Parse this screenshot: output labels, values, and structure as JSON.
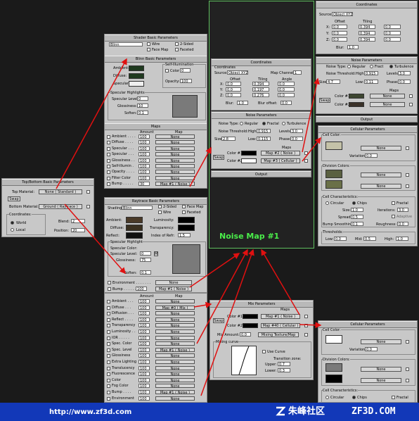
{
  "footer": {
    "url": "http://www.zf3d.com",
    "brand_cn": "朱峰社区",
    "brand_en": "ZF3D.COM"
  },
  "callout": {
    "noise_map_1": "Noise Map #1"
  },
  "shader_basic": {
    "title": "Shader Basic Parameters",
    "shader": "Blinn",
    "wire": "Wire",
    "two_sided": "2-Sided",
    "face_map": "Face Map",
    "faceted": "Faceted"
  },
  "blinn_basic": {
    "title": "Blinn Basic Parameters",
    "self_illum": "Self-Illumination",
    "ambient": "Ambient:",
    "diffuse": "Diffuse:",
    "specular": "Specular:",
    "color": "Color",
    "color_val": "0",
    "opacity": "Opacity:",
    "opacity_val": "100",
    "spec_highlights": "Specular Highlights",
    "spec_level": "Specular Level:",
    "spec_level_val": "0",
    "glossiness": "Glossiness:",
    "glossiness_val": "10",
    "soften": "Soften:",
    "soften_val": "0.1"
  },
  "maps1": {
    "title": "Maps",
    "amount": "Amount",
    "map": "Map",
    "rows": [
      {
        "name": "Ambient . . . .",
        "amt": "100",
        "map": "None"
      },
      {
        "name": "Diffuse . . . .",
        "amt": "100",
        "map": "None"
      },
      {
        "name": "Specular . . .",
        "amt": "100",
        "map": "None"
      },
      {
        "name": "Specular . . .",
        "amt": "100",
        "map": "None"
      },
      {
        "name": "Glossiness . .",
        "amt": "100",
        "map": "None"
      },
      {
        "name": "Self-Illumin .",
        "amt": "100",
        "map": "None"
      },
      {
        "name": "Opacity . . . .",
        "amt": "100",
        "map": "None"
      },
      {
        "name": "Filter Color",
        "amt": "100",
        "map": "None"
      },
      {
        "name": "Bump . . . . .",
        "amt": "30",
        "map": "Map #1 ( Noise )"
      }
    ]
  },
  "topbottom": {
    "title": "Top/Bottom Basic Parameters",
    "top_material": "Top Material:",
    "top_val": "None ( Standard )",
    "swap": "Swap",
    "bottom_material": "Bottom Material:",
    "bottom_val": "Ground ( Raytrace )",
    "coordinates": "Coordinates:",
    "world": "World",
    "local": "Local",
    "blend": "Blend:",
    "blend_val": "2",
    "position": "Position:",
    "position_val": "20"
  },
  "coord1": {
    "title": "Coordinates",
    "coordinates": "Coordinates",
    "source": "Source:",
    "source_val": "Object XYZ",
    "map_channel": "Map Channel:",
    "map_channel_val": "1",
    "offset": "Offset",
    "tiling": "Tiling",
    "angle": "Angle",
    "x": "X:",
    "y": "Y:",
    "z": "Z:",
    "ox": "0.0",
    "oy": "0.0",
    "oz": "0.0",
    "tx": "0.394",
    "ty": "0.197",
    "tz": "0.276",
    "ax": "0.0",
    "ay": "0.0",
    "az": "0.0",
    "blur": "Blur:",
    "blur_val": "1.0",
    "blur_offset": "Blur offset:",
    "blur_offset_val": "0.0"
  },
  "noise1": {
    "title": "Noise Parameters",
    "noise_type": "Noise Type:",
    "regular": "Regular",
    "fractal": "Fractal",
    "turbulence": "Turbulence",
    "threshold": "Noise Threshold:",
    "high": "High:",
    "high_val": "0.915",
    "levels": "Levels:",
    "levels_val": "3.0",
    "size": "Size:",
    "size_val": "2.8",
    "low": "Low:",
    "low_val": "0.115",
    "phase": "Phase:",
    "phase_val": "0.0",
    "maps": "Maps",
    "color1": "Color #1",
    "color2": "Color #2",
    "swap": "Swap",
    "map2": "Map #2 ( Noise )",
    "map3": "Map #3 ( Cellular )"
  },
  "output1": {
    "title": "Output"
  },
  "coord2": {
    "title": "Coordinates",
    "source": "Source:",
    "source_val": "Object XYZ",
    "offset": "Offset",
    "tiling": "Tiling",
    "x": "X:",
    "y": "Y:",
    "z": "Z:",
    "ox": "0.0",
    "oy": "0.0",
    "oz": "0.0",
    "tx": "0.394",
    "ty": "0.394",
    "tz": "0.394",
    "ax": "0.0",
    "ay": "0.0",
    "az": "0.0",
    "blur": "Blur:",
    "blur_val": "1.0"
  },
  "noise2": {
    "title": "Noise Parameters",
    "noise_type": "Noise Type:",
    "regular": "Regular",
    "fractal": "Fract",
    "turbulence": "Turbulence",
    "threshold": "Noise Threshold:",
    "high": "High:",
    "high_val": "0.915",
    "levels": "Levels:",
    "levels_val": "3.0",
    "size": "Size:",
    "size_val": "4.7",
    "low": "Low:",
    "low_val": "0.11",
    "phase": "Phase:",
    "phase_val": "0.0",
    "maps": "Maps",
    "color1": "Color #1",
    "color2": "Color #2",
    "swap": "Swap",
    "none1": "None",
    "none2": "None"
  },
  "output2": {
    "title": "Output"
  },
  "cellular1": {
    "title": "Cellular Parameters",
    "cell_color": "Cell Color:",
    "none": "None",
    "variation": "Variation:",
    "variation_val": "0.0",
    "division_colors": "Division Colors:",
    "none2": "None",
    "none3": "None",
    "cell_char": "Cell Characteristics:",
    "circular": "Circular",
    "chips": "Chips",
    "fractal": "Fractal",
    "size": "Size:",
    "size_val": "1.0",
    "iterations": "Iterations:",
    "iterations_val": "3.0",
    "spread": "Spread:",
    "spread_val": "0.5",
    "adaptive": "Adaptive",
    "bump_smoothing": "Bump Smoothing:",
    "bump_val": "0.1",
    "roughness": "Roughness:",
    "roughness_val": "0.0",
    "thresholds": "Thresholds:",
    "low": "Low:",
    "low_val": "0.0",
    "mid": "Mid:",
    "mid_val": "0.5",
    "high": "High:",
    "high_val": "1.0"
  },
  "raytrace": {
    "title": "Raytrace Basic Parameters",
    "shading": "Shading:",
    "shading_val": "Blinn",
    "two_sided": "2-Sided",
    "face_map": "Face Map",
    "wire": "Wire",
    "faceted": "Faceted",
    "ambient": "Ambient:",
    "diffuse": "Diffuse:",
    "reflect": "Reflect:",
    "luminosity": "Luminosity:",
    "transparency": "Transparency:",
    "ior": "Index of Refr:",
    "ior_val": "1.5",
    "spec_highlight": "Specular Highlight",
    "spec_color": "Specular Color:",
    "spec_level": "Specular Level:",
    "spec_level_val": "0",
    "glossiness": "Glossiness:",
    "glossiness_val": "75",
    "soften": "Soften:",
    "soften_val": "0.1",
    "environment": "Environment . . . . . . .",
    "env_map": "None",
    "bump": "Bump . . . . . .",
    "bump_amt": "100",
    "bump_map": "Map #1 ( Noise )"
  },
  "maps2": {
    "amount": "Amount",
    "map": "Map",
    "rows": [
      {
        "name": "Ambient . . .",
        "amt": "100",
        "map": "None"
      },
      {
        "name": "Diffuse . . .",
        "amt": "100",
        "map": "Map #0 ( Mix )"
      },
      {
        "name": "Diffusion . . .",
        "amt": "100",
        "map": "None"
      },
      {
        "name": "Reflect . . . .",
        "amt": "100",
        "map": "None"
      },
      {
        "name": "Transparency",
        "amt": "100",
        "map": "None"
      },
      {
        "name": "Luminosity . .",
        "amt": "100",
        "map": "None"
      },
      {
        "name": "IOR . . . . .",
        "amt": "100",
        "map": "None"
      },
      {
        "name": "Spec. Color",
        "amt": "100",
        "map": "None"
      },
      {
        "name": "Spec. Level",
        "amt": "100",
        "map": "Map #1 ( Noise )"
      },
      {
        "name": "Glossiness",
        "amt": "100",
        "map": "None"
      },
      {
        "name": "Extra Lighting",
        "amt": "100",
        "map": "None"
      },
      {
        "name": "Translucency",
        "amt": "100",
        "map": "None"
      },
      {
        "name": "Fluorescence",
        "amt": "100",
        "map": "None"
      },
      {
        "name": "Color",
        "amt": "100",
        "map": "None"
      },
      {
        "name": "Fog Color",
        "amt": "100",
        "map": "None"
      },
      {
        "name": "Bump . . . .",
        "amt": "100",
        "map": "Map #1 ( Noise )"
      },
      {
        "name": "Environment",
        "amt": "100",
        "map": "None"
      }
    ]
  },
  "mix": {
    "title": "Mix Parameters",
    "maps": "Maps",
    "swap": "Swap",
    "color1": "Color #1",
    "color2": "Color #2",
    "map1": "Map #1 ( Noise )",
    "map40": "Map #40 ( Cellular )",
    "mix_amount": "Mix Amount:",
    "mix_amount_val": "0.0",
    "mixing_texture": "Mixing Texture/Map",
    "mixing_curve": "Mixing curve",
    "use_curve": "Use Curve",
    "transition_zone": "Transition zone:",
    "upper": "Upper:",
    "upper_val": "0.7",
    "lower": "Lower:",
    "lower_val": "0.3"
  },
  "cellular2": {
    "title": "Cellular Parameters",
    "cell_color": "Cell Color:",
    "none": "None",
    "variation": "Variation:",
    "variation_val": "0.0",
    "division_colors": "Division Colors:",
    "none2": "None",
    "none3": "None",
    "cell_char": "Cell Characteristics:",
    "circular": "Circular",
    "chips": "Chips",
    "fractal": "Fractal"
  },
  "colors": {
    "arrow": "#e01010",
    "callout": "#4aee4a",
    "green_frame": "#5fbf5f",
    "footer": "#1238b8"
  }
}
